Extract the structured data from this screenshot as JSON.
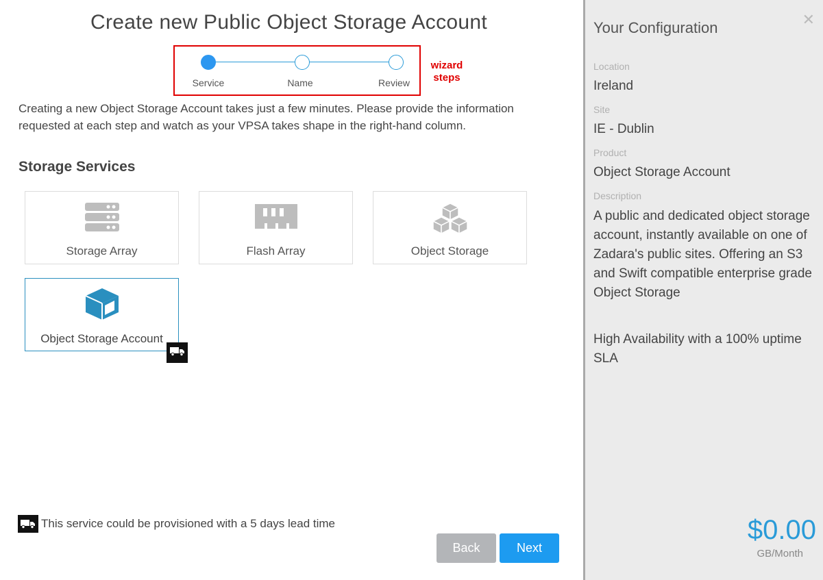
{
  "page": {
    "title": "Create new Public Object Storage Account",
    "intro": "Creating a new Object Storage Account takes just a few minutes. Please provide the information requested at each step and watch as your VPSA takes shape in the right-hand column."
  },
  "wizard": {
    "steps": [
      {
        "label": "Service",
        "active": true
      },
      {
        "label": "Name",
        "active": false
      },
      {
        "label": "Review",
        "active": false
      }
    ],
    "annotation_line1": "wizard",
    "annotation_line2": "steps"
  },
  "services": {
    "heading": "Storage Services",
    "items": [
      {
        "label": "Storage Array",
        "icon": "server-stack-icon",
        "selected": false
      },
      {
        "label": "Flash Array",
        "icon": "memory-chip-icon",
        "selected": false
      },
      {
        "label": "Object Storage",
        "icon": "cubes-icon",
        "selected": false
      },
      {
        "label": "Object Storage Account",
        "icon": "cube-icon",
        "selected": true,
        "lead_time_badge": "truck-icon"
      }
    ]
  },
  "footer": {
    "lead_time_icon": "truck-icon",
    "lead_time_text": "This service could be provisioned with a 5 days lead time",
    "back_label": "Back",
    "next_label": "Next"
  },
  "sidebar": {
    "title": "Your Configuration",
    "close_icon": "close-icon",
    "fields": [
      {
        "label": "Location",
        "value": "Ireland"
      },
      {
        "label": "Site",
        "value": "IE - Dublin"
      },
      {
        "label": "Product",
        "value": "Object Storage Account"
      },
      {
        "label": "Description",
        "value": ""
      }
    ],
    "description": "A public and dedicated object storage account, instantly available on one of Zadara's public sites. Offering an S3 and Swift compatible enterprise grade Object Storage",
    "description2": "High Availability with a 100% uptime SLA",
    "price": "$0.00",
    "price_unit": "GB/Month"
  },
  "colors": {
    "accent": "#2a9bd8",
    "next_button": "#1d9bf0",
    "back_button": "#b3b5b8",
    "annotation": "#e00000",
    "icon_gray": "#bdbdbd",
    "icon_selected": "#2a8fbf"
  }
}
